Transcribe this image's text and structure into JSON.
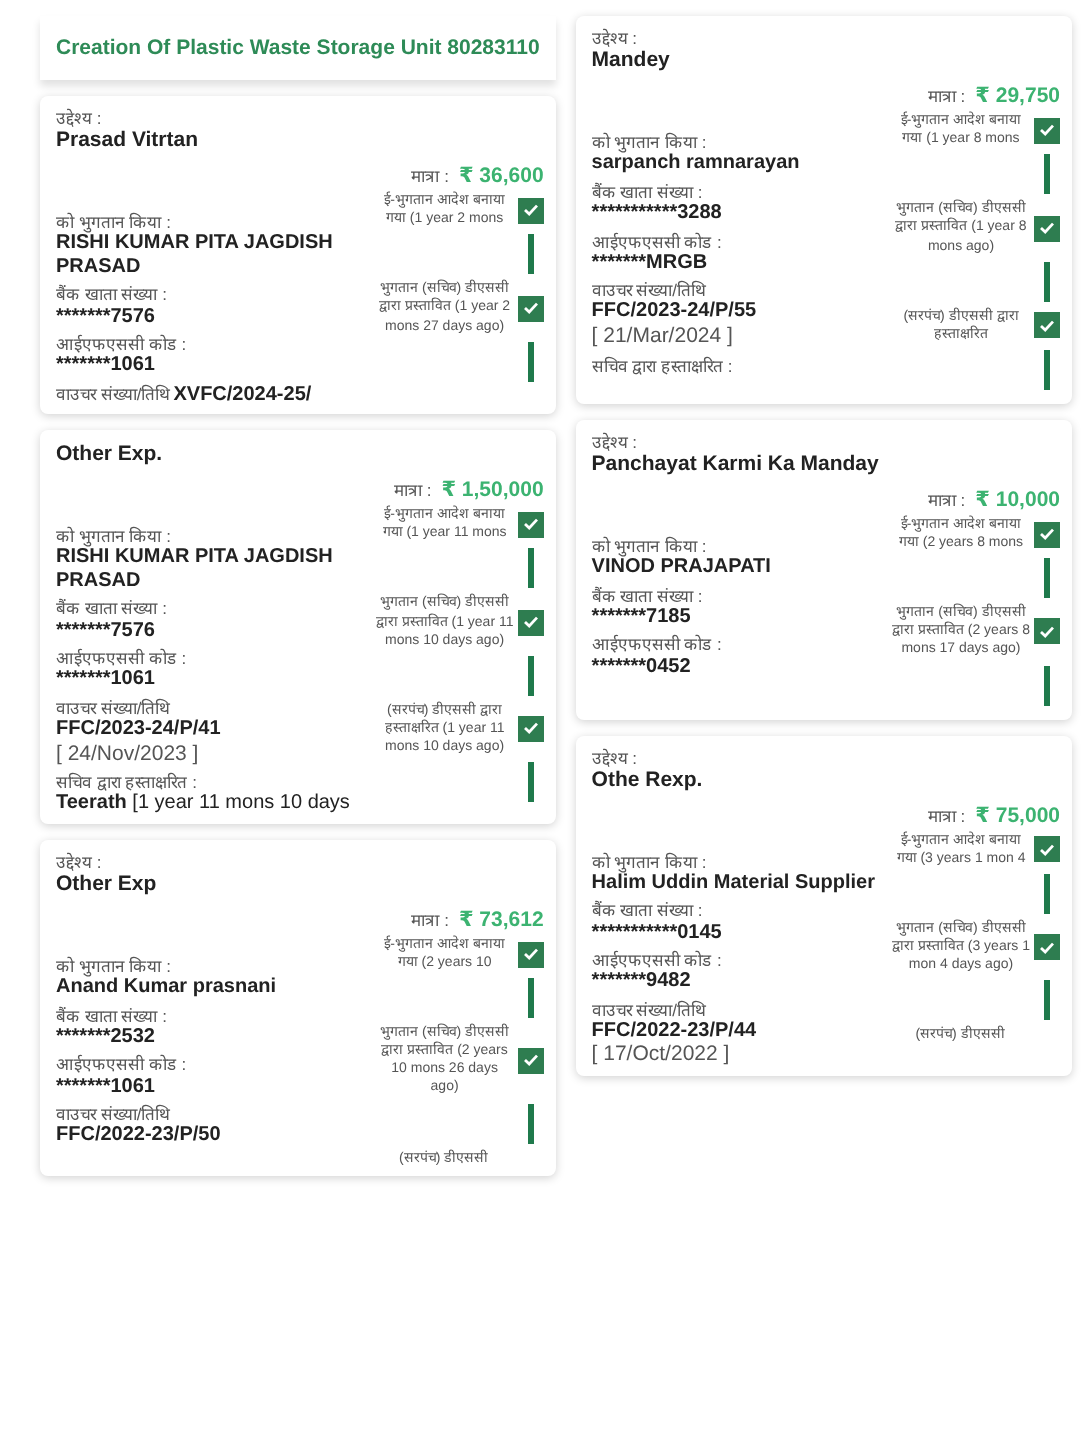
{
  "header": {
    "title": "Creation Of Plastic Waste Storage Unit  80283110"
  },
  "columns": [
    {
      "cards": [
        {
          "purpose_label": "उद्देश्य :",
          "purpose": "Prasad Vitrtan",
          "amount_label": "मात्रा :",
          "amount": "₹ 36,600",
          "fields": [
            {
              "label": "को भुगतान किया :",
              "value": "RISHI KUMAR PITA  JAGDISH PRASAD"
            },
            {
              "label": "बैंक खाता संख्या :",
              "value": "*******7576"
            },
            {
              "label": "आईएफएससी कोड :",
              "value": "*******1061"
            },
            {
              "label": "वाउचर संख्या/तिथि",
              "value": "XVFC/2024-25/",
              "kind": "inline"
            }
          ],
          "steps": [
            {
              "text": "ई-भुगतान आदेश बनाया गया (1 year 2 mons",
              "checked": true
            },
            {
              "text": "भुगतान (सचिव) डीएससी द्वारा प्रस्तावित (1 year 2 mons 27 days ago)",
              "checked": true
            }
          ]
        },
        {
          "purpose": "Other Exp.",
          "amount_label": "मात्रा :",
          "amount": "₹ 1,50,000",
          "fields": [
            {
              "label": "को भुगतान किया :",
              "value": "RISHI KUMAR PITA  JAGDISH PRASAD"
            },
            {
              "label": "बैंक खाता संख्या :",
              "value": "*******7576"
            },
            {
              "label": "आईएफएससी कोड :",
              "value": "*******1061"
            },
            {
              "label": "वाउचर संख्या/तिथि",
              "value": "FFC/2023-24/P/41",
              "date": "[ 24/Nov/2023 ]"
            },
            {
              "label": "सचिव द्वारा हस्ताक्षरित :",
              "value": "Teerath",
              "note": "[1 year 11 mons 10 days"
            }
          ],
          "steps": [
            {
              "text": "ई-भुगतान आदेश बनाया गया (1 year 11 mons",
              "checked": true
            },
            {
              "text": "भुगतान (सचिव) डीएससी द्वारा प्रस्तावित (1 year 11 mons 10 days ago)",
              "checked": true
            },
            {
              "text": "(सरपंच) डीएससी द्वारा हस्ताक्षरित (1 year 11 mons 10 days ago)",
              "checked": true
            }
          ]
        },
        {
          "purpose_label": "उद्देश्य :",
          "purpose": "Other Exp",
          "amount_label": "मात्रा :",
          "amount": "₹ 73,612",
          "fields": [
            {
              "label": "को भुगतान किया :",
              "value": "Anand Kumar prasnani"
            },
            {
              "label": "बैंक खाता संख्या :",
              "value": "*******2532"
            },
            {
              "label": "आईएफएससी कोड :",
              "value": "*******1061"
            },
            {
              "label": "वाउचर संख्या/तिथि",
              "value": "FFC/2022-23/P/50"
            }
          ],
          "steps": [
            {
              "text": "ई-भुगतान आदेश बनाया गया (2 years 10",
              "checked": true
            },
            {
              "text": "भुगतान (सचिव) डीएससी द्वारा प्रस्तावित (2 years 10 mons 26 days ago)",
              "checked": true
            },
            {
              "text": "(सरपंच) डीएससी"
            }
          ]
        }
      ]
    },
    {
      "cards": [
        {
          "purpose_label": "उद्देश्य :",
          "purpose": "Mandey",
          "amount_label": "मात्रा :",
          "amount": "₹ 29,750",
          "fields": [
            {
              "label": "को भुगतान किया :",
              "value": "sarpanch ramnarayan"
            },
            {
              "label": "बैंक खाता संख्या :",
              "value": "***********3288"
            },
            {
              "label": "आईएफएससी कोड :",
              "value": "*******MRGB"
            },
            {
              "label": "वाउचर संख्या/तिथि",
              "value": "FFC/2023-24/P/55",
              "date": "[ 21/Mar/2024 ]"
            },
            {
              "label": "सचिव द्वारा हस्ताक्षरित :"
            }
          ],
          "steps": [
            {
              "text": "ई-भुगतान आदेश बनाया गया (1 year 8 mons",
              "checked": true
            },
            {
              "text": "भुगतान (सचिव) डीएससी द्वारा प्रस्तावित (1 year 8 mons ago)",
              "checked": true
            },
            {
              "text": "(सरपंच) डीएससी द्वारा हस्ताक्षरित",
              "checked": true
            }
          ]
        },
        {
          "purpose_label": "उद्देश्य :",
          "purpose": "Panchayat Karmi Ka Manday",
          "amount_label": "मात्रा :",
          "amount": "₹ 10,000",
          "fields": [
            {
              "label": "को भुगतान किया :",
              "value": "VINOD PRAJAPATI"
            },
            {
              "label": "बैंक खाता संख्या :",
              "value": "*******7185"
            },
            {
              "label": "आईएफएससी कोड :",
              "value": "*******0452"
            }
          ],
          "steps": [
            {
              "text": "ई-भुगतान आदेश बनाया गया (2 years 8 mons",
              "checked": true
            },
            {
              "text": "भुगतान (सचिव) डीएससी द्वारा प्रस्तावित (2 years 8 mons 17 days ago)",
              "checked": true
            }
          ]
        },
        {
          "purpose_label": "उद्देश्य :",
          "purpose": "Othe Rexp.",
          "amount_label": "मात्रा :",
          "amount": "₹ 75,000",
          "fields": [
            {
              "label": "को भुगतान किया :",
              "value": "Halim Uddin Material Supplier"
            },
            {
              "label": "बैंक खाता संख्या :",
              "value": "***********0145"
            },
            {
              "label": "आईएफएससी कोड :",
              "value": "*******9482"
            },
            {
              "label": "वाउचर संख्या/तिथि",
              "value": "FFC/2022-23/P/44",
              "date": "[ 17/Oct/2022 ]"
            }
          ],
          "steps": [
            {
              "text": "ई-भुगतान आदेश बनाया गया (3 years 1 mon 4",
              "checked": true
            },
            {
              "text": "भुगतान (सचिव) डीएससी द्वारा प्रस्तावित (3 years 1 mon 4 days ago)",
              "checked": true
            },
            {
              "text": "(सरपंच) डीएससी"
            }
          ]
        }
      ]
    }
  ]
}
